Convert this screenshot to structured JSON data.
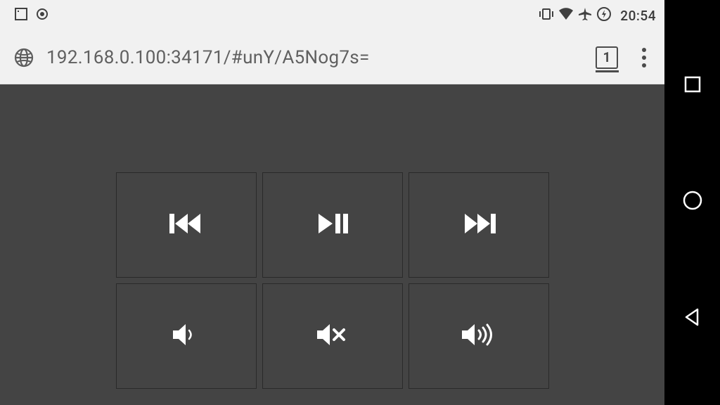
{
  "status": {
    "time": "20:54",
    "icons": [
      "square-notif",
      "target-notif",
      "vibrate",
      "wifi",
      "airplane",
      "battery-charging"
    ]
  },
  "browser": {
    "url": "192.168.0.100:34171/#unY/A5Nog7s=",
    "tab_count": "1"
  },
  "controls": {
    "row1": [
      "previous",
      "play-pause",
      "next"
    ],
    "row2": [
      "volume-down",
      "mute",
      "volume-up"
    ]
  },
  "navbar": [
    "recent",
    "home",
    "back"
  ]
}
